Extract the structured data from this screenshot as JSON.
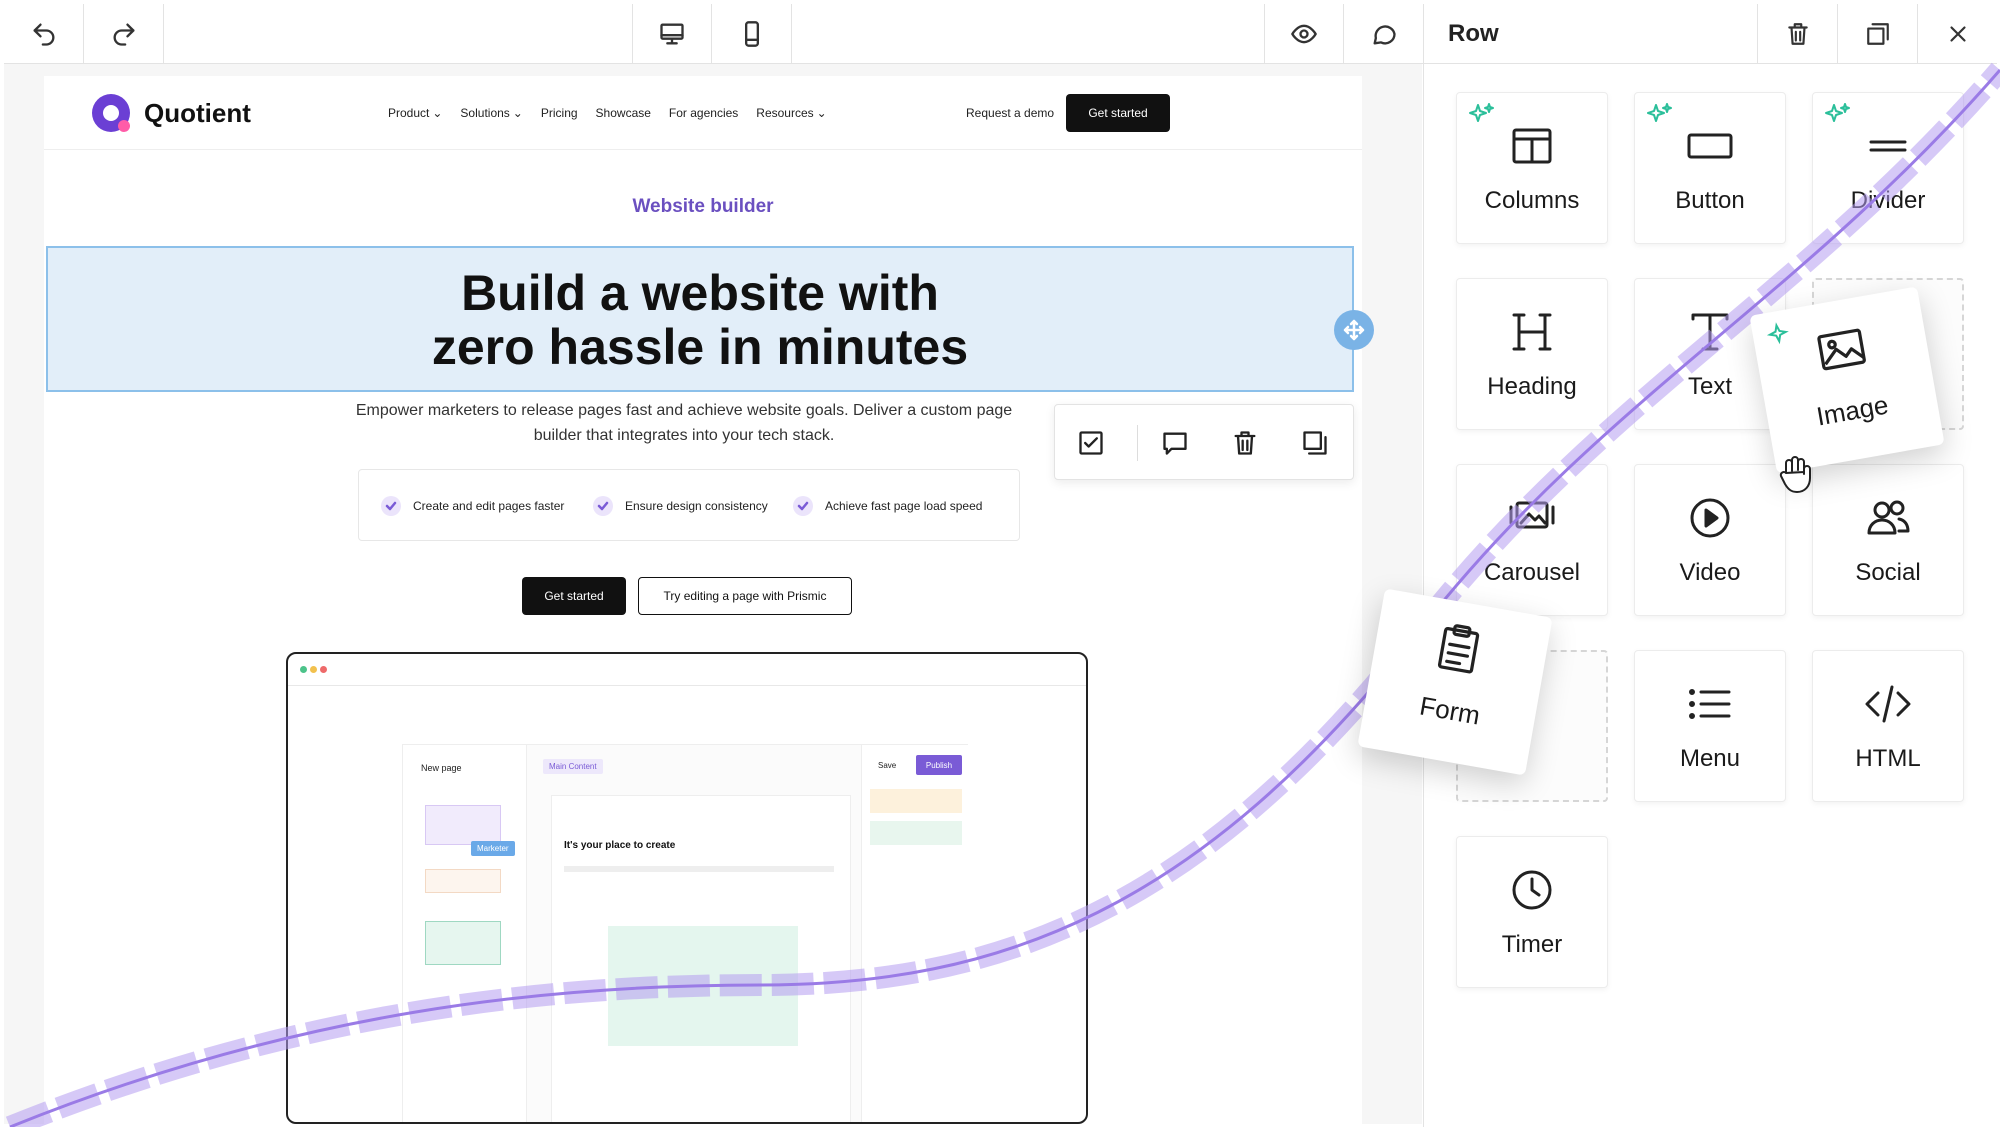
{
  "toolbar": {
    "undo_icon": "undo-icon",
    "redo_icon": "redo-icon",
    "desktop_icon": "desktop-icon",
    "mobile_icon": "mobile-icon",
    "preview_icon": "eye-icon",
    "comment_icon": "comment-icon"
  },
  "panel": {
    "title": "Row",
    "tiles": [
      {
        "label": "Columns",
        "icon": "columns-icon"
      },
      {
        "label": "Button",
        "icon": "button-icon"
      },
      {
        "label": "Divider",
        "icon": "divider-icon"
      },
      {
        "label": "Heading",
        "icon": "heading-icon"
      },
      {
        "label": "Text",
        "icon": "text-icon"
      },
      {
        "label": "Carousel",
        "icon": "carousel-icon"
      },
      {
        "label": "Video",
        "icon": "video-icon"
      },
      {
        "label": "Social",
        "icon": "social-icon"
      },
      {
        "label": "Menu",
        "icon": "menu-icon"
      },
      {
        "label": "HTML",
        "icon": "code-icon"
      },
      {
        "label": "Timer",
        "icon": "clock-icon"
      }
    ],
    "dragging": [
      {
        "label": "Image",
        "icon": "image-icon"
      },
      {
        "label": "Form",
        "icon": "clipboard-icon"
      }
    ],
    "accent_color": "#2bbf9a"
  },
  "site": {
    "brand": "Quotient",
    "nav": [
      "Product",
      "Solutions",
      "Pricing",
      "Showcase",
      "For agencies",
      "Resources"
    ],
    "nav_demo": "Request a demo",
    "nav_cta": "Get started",
    "eyebrow": "Website builder",
    "hero_line1": "Build a website with",
    "hero_line2": "zero hassle in minutes",
    "hero_sub": "Empower marketers to release pages fast and achieve website goals. Deliver a custom page builder that integrates into your tech stack.",
    "features": [
      "Create and edit pages faster",
      "Ensure design consistency",
      "Achieve fast page load speed"
    ],
    "cta_primary": "Get started",
    "cta_secondary": "Try editing a page with Prismic",
    "mock": {
      "new_page": "New page",
      "main_content": "Main Content",
      "save": "Save",
      "publish": "Publish",
      "heading": "It's your place to create",
      "marker": "Marketer"
    },
    "brand_color": "#6b3fd4",
    "selection_color": "#e2eef9"
  }
}
